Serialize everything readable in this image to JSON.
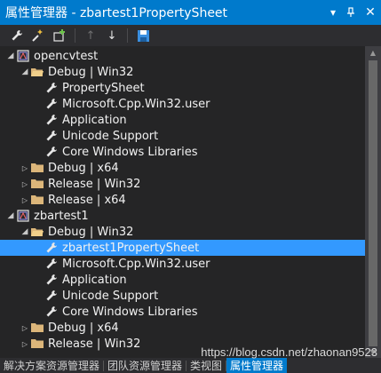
{
  "window": {
    "title": "属性管理器 - zbartest1PropertySheet",
    "dropdown_glyph": "▾",
    "pin_glyph": "ᚴ",
    "close_glyph": "✕"
  },
  "toolbar": {
    "up_glyph": "↑",
    "down_glyph": "↓"
  },
  "tree": {
    "expanded_glyph": "◢",
    "collapsed_glyph": "▷",
    "rows": [
      {
        "text": "opencvtest",
        "level": 0,
        "kind": "project",
        "expander": "expanded"
      },
      {
        "text": "Debug | Win32",
        "level": 1,
        "kind": "folder-open",
        "expander": "expanded"
      },
      {
        "text": "PropertySheet",
        "level": 2,
        "kind": "sheet",
        "expander": "none"
      },
      {
        "text": "Microsoft.Cpp.Win32.user",
        "level": 2,
        "kind": "sheet",
        "expander": "none"
      },
      {
        "text": "Application",
        "level": 2,
        "kind": "sheet",
        "expander": "none"
      },
      {
        "text": "Unicode Support",
        "level": 2,
        "kind": "sheet",
        "expander": "none"
      },
      {
        "text": "Core Windows Libraries",
        "level": 2,
        "kind": "sheet",
        "expander": "none"
      },
      {
        "text": "Debug | x64",
        "level": 1,
        "kind": "folder",
        "expander": "collapsed"
      },
      {
        "text": "Release | Win32",
        "level": 1,
        "kind": "folder",
        "expander": "collapsed"
      },
      {
        "text": "Release | x64",
        "level": 1,
        "kind": "folder",
        "expander": "collapsed"
      },
      {
        "text": "zbartest1",
        "level": 0,
        "kind": "project",
        "expander": "expanded"
      },
      {
        "text": "Debug | Win32",
        "level": 1,
        "kind": "folder-open",
        "expander": "expanded"
      },
      {
        "text": "zbartest1PropertySheet",
        "level": 2,
        "kind": "sheet",
        "expander": "none",
        "selected": true
      },
      {
        "text": "Microsoft.Cpp.Win32.user",
        "level": 2,
        "kind": "sheet",
        "expander": "none"
      },
      {
        "text": "Application",
        "level": 2,
        "kind": "sheet",
        "expander": "none"
      },
      {
        "text": "Unicode Support",
        "level": 2,
        "kind": "sheet",
        "expander": "none"
      },
      {
        "text": "Core Windows Libraries",
        "level": 2,
        "kind": "sheet",
        "expander": "none"
      },
      {
        "text": "Debug | x64",
        "level": 1,
        "kind": "folder",
        "expander": "collapsed"
      },
      {
        "text": "Release | Win32",
        "level": 1,
        "kind": "folder",
        "expander": "collapsed"
      }
    ]
  },
  "scrollbar": {
    "up_glyph": "▲",
    "down_glyph": "▼"
  },
  "tabs": [
    {
      "label": "解决方案资源管理器",
      "active": false
    },
    {
      "label": "团队资源管理器",
      "active": false
    },
    {
      "label": "类视图",
      "active": false
    },
    {
      "label": "属性管理器",
      "active": true
    }
  ],
  "watermark": "https://blog.csdn.net/zhaonan9523",
  "colors": {
    "accent": "#007acc",
    "selection": "#3399ff",
    "background": "#252526",
    "folder": "#dcb67a"
  }
}
